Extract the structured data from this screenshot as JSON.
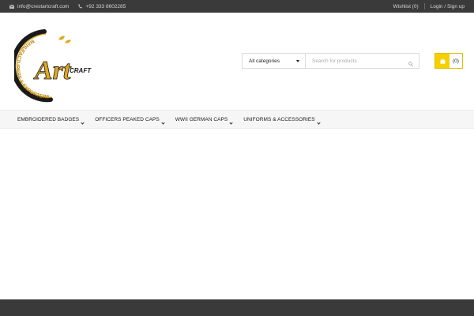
{
  "topbar": {
    "email": "info@crestartcraft.com",
    "phone": "+92 333 8602285",
    "wishlist": "Wishlist (0)",
    "login": "Login / Sign up"
  },
  "logo": {
    "main_text": "Art",
    "sub_text": "CRAFT",
    "ring_text": "MANUFACTURERS & EXPORTERS",
    "colors": {
      "gold": "#e0a81c",
      "dark": "#1a1a1a"
    }
  },
  "search": {
    "category_selected": "All categories",
    "placeholder": "Search for products"
  },
  "cart": {
    "count": "(0)",
    "accent": "#f5cf00"
  },
  "nav": {
    "items": [
      {
        "label": "EMBROIDERED BADGES"
      },
      {
        "label": "OFFICERS PEAKED CAPS"
      },
      {
        "label": "WWII GERMAN CAPS"
      },
      {
        "label": "UNIFORMS & ACCESSORIES"
      }
    ]
  }
}
